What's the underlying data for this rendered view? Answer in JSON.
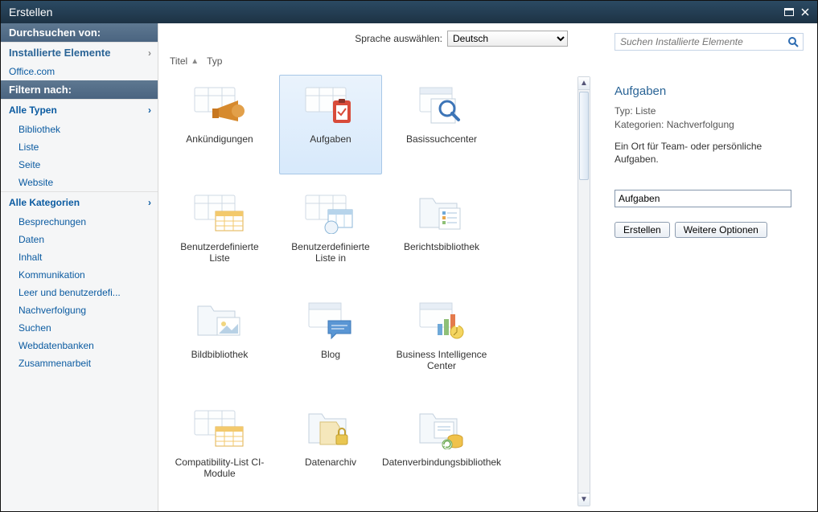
{
  "dialog": {
    "title": "Erstellen"
  },
  "sidebar": {
    "browse_head": "Durchsuchen von:",
    "installed": "Installierte Elemente",
    "office": "Office.com",
    "filter_head": "Filtern nach:",
    "all_types": "Alle Typen",
    "types": [
      "Bibliothek",
      "Liste",
      "Seite",
      "Website"
    ],
    "all_categories": "Alle Kategorien",
    "categories": [
      "Besprechungen",
      "Daten",
      "Inhalt",
      "Kommunikation",
      "Leer und benutzerdefi...",
      "Nachverfolgung",
      "Suchen",
      "Webdatenbanken",
      "Zusammenarbeit"
    ]
  },
  "topbar": {
    "lang_label": "Sprache auswählen:",
    "lang_value": "Deutsch",
    "search_placeholder": "Suchen Installierte Elemente"
  },
  "columns": {
    "title": "Titel",
    "type": "Typ"
  },
  "items": [
    {
      "label": "Ankündigungen",
      "icon": "megaphone"
    },
    {
      "label": "Aufgaben",
      "icon": "clipboard-check",
      "selected": true
    },
    {
      "label": "Basissuchcenter",
      "icon": "magnifier-page"
    },
    {
      "label": "Benutzerdefinierte Liste",
      "icon": "custom-list"
    },
    {
      "label": "Benutzerdefinierte Liste in",
      "icon": "custom-list-grid"
    },
    {
      "label": "Berichtsbibliothek",
      "icon": "report-library"
    },
    {
      "label": "Bildbibliothek",
      "icon": "image-library"
    },
    {
      "label": "Blog",
      "icon": "blog"
    },
    {
      "label": "Business Intelligence Center",
      "icon": "bi-center"
    },
    {
      "label": "Compatibility-List CI-Module",
      "icon": "custom-list"
    },
    {
      "label": "Datenarchiv",
      "icon": "archive-lock"
    },
    {
      "label": "Datenverbindungsbibliothek",
      "icon": "data-connection"
    }
  ],
  "details": {
    "title": "Aufgaben",
    "type_label": "Typ:",
    "type_value": "Liste",
    "cat_label": "Kategorien:",
    "cat_value": "Nachverfolgung",
    "desc": "Ein Ort für Team- oder persönliche Aufgaben.",
    "name_value": "Aufgaben",
    "create": "Erstellen",
    "more": "Weitere Optionen"
  }
}
